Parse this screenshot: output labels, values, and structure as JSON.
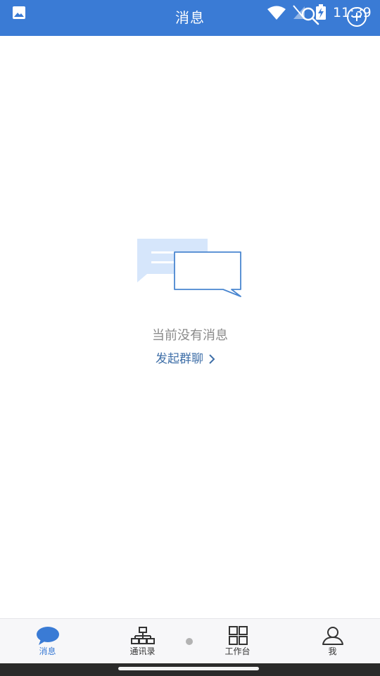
{
  "header": {
    "title": "消息",
    "clock": "11:39",
    "color": "#3a7bd5"
  },
  "empty_state": {
    "message": "当前没有消息",
    "action_label": "发起群聊",
    "action_color": "#3f6fa8",
    "illustration_icon": "chat-bubbles-icon"
  },
  "tabbar": {
    "tabs": [
      {
        "label": "消息",
        "icon": "chat-bubble-icon",
        "active": true
      },
      {
        "label": "通讯录",
        "icon": "org-chart-icon",
        "active": false
      },
      {
        "label": "工作台",
        "icon": "grid-icon",
        "active": false
      },
      {
        "label": "我",
        "icon": "user-icon",
        "active": false
      }
    ],
    "active_color": "#3a7bd5"
  }
}
